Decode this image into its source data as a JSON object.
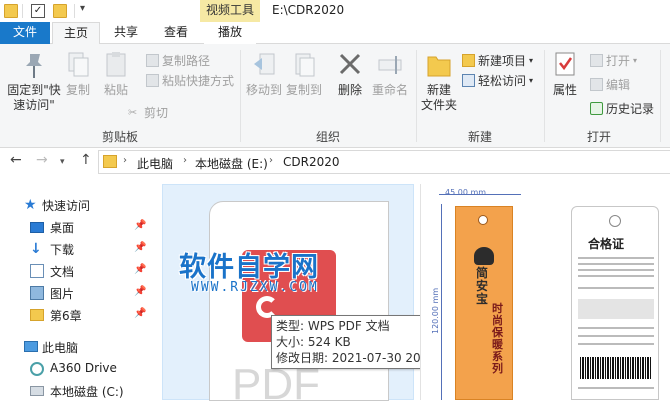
{
  "window": {
    "context_tab": "视频工具",
    "title": "E:\\CDR2020"
  },
  "tabs": [
    "文件",
    "主页",
    "共享",
    "查看",
    "播放"
  ],
  "ribbon": {
    "clipboard": {
      "pin_label_line1": "固定到\"快",
      "pin_label_line2": "速访问\"",
      "copy": "复制",
      "paste": "粘贴",
      "copy_path": "复制路径",
      "paste_shortcut": "粘贴快捷方式",
      "cut": "剪切",
      "group": "剪贴板"
    },
    "organize": {
      "move_to": "移动到",
      "copy_to": "复制到",
      "delete": "删除",
      "rename": "重命名",
      "group": "组织"
    },
    "new": {
      "new_folder_line1": "新建",
      "new_folder_line2": "文件夹",
      "new_item": "新建项目",
      "easy_access": "轻松访问",
      "group": "新建"
    },
    "open": {
      "properties": "属性",
      "open": "打开",
      "edit": "编辑",
      "history": "历史记录",
      "group": "打开"
    }
  },
  "address": {
    "crumbs": [
      "此电脑",
      "本地磁盘 (E:)",
      "CDR2020"
    ]
  },
  "nav": {
    "quick_access": "快速访问",
    "items": [
      {
        "label": "桌面",
        "pinned": true
      },
      {
        "label": "下载",
        "pinned": true
      },
      {
        "label": "文档",
        "pinned": true
      },
      {
        "label": "图片",
        "pinned": true
      },
      {
        "label": "第6章",
        "pinned": true
      }
    ],
    "this_pc": "此电脑",
    "drives": [
      "A360 Drive",
      "本地磁盘 (C:)"
    ]
  },
  "content": {
    "pdf_label": "PDF",
    "watermark": "软件自学网",
    "watermark_url": "WWW.RJZXW.COM",
    "tooltip": {
      "type": "类型: WPS PDF 文档",
      "size": "大小: 524 KB",
      "modified": "修改日期: 2021-07-30 20:37"
    },
    "thumb2": {
      "width_dim": "45.00 mm",
      "height_dim": "120.00 mm",
      "brand_text": "简安宝",
      "product_text": "时尚保暖系列",
      "cert_title": "合格证"
    }
  }
}
